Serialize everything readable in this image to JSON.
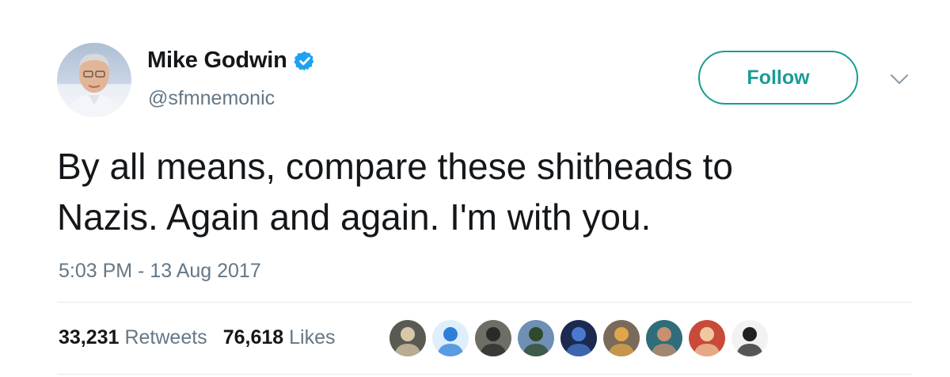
{
  "author": {
    "display_name": "Mike Godwin",
    "handle": "@sfmnemonic",
    "verified": true,
    "avatar_icon": "profile-photo-icon"
  },
  "follow_label": "Follow",
  "tweet": {
    "text": "By all means, compare these shitheads to\nNazis. Again and again. I'm with you.",
    "timestamp": "5:03 PM - 13 Aug 2017"
  },
  "stats": {
    "retweets_count": "33,231",
    "retweets_label": "Retweets",
    "likes_count": "76,618",
    "likes_label": "Likes"
  },
  "likers": [
    {
      "name": "liker-avatar-1",
      "bg": "#5a5a55",
      "fg": "#d9c8a8"
    },
    {
      "name": "liker-avatar-2",
      "bg": "#dfeefb",
      "fg": "#2f7fd9"
    },
    {
      "name": "liker-avatar-3",
      "bg": "#6e6e66",
      "fg": "#2a2a28"
    },
    {
      "name": "liker-avatar-4",
      "bg": "#6f8fb4",
      "fg": "#2f4a2a"
    },
    {
      "name": "liker-avatar-5",
      "bg": "#1b2a4f",
      "fg": "#4a7ad0"
    },
    {
      "name": "liker-avatar-6",
      "bg": "#7a6a5a",
      "fg": "#e0a64a"
    },
    {
      "name": "liker-avatar-7",
      "bg": "#2f6d7a",
      "fg": "#c89070"
    },
    {
      "name": "liker-avatar-8",
      "bg": "#c94a3a",
      "fg": "#f0c8a0"
    },
    {
      "name": "liker-avatar-9",
      "bg": "#f2f2f2",
      "fg": "#222222"
    }
  ],
  "colors": {
    "accent": "#1a9c94",
    "verified": "#1da1f2",
    "secondary_text": "#657786",
    "divider": "#e1e8ed"
  }
}
